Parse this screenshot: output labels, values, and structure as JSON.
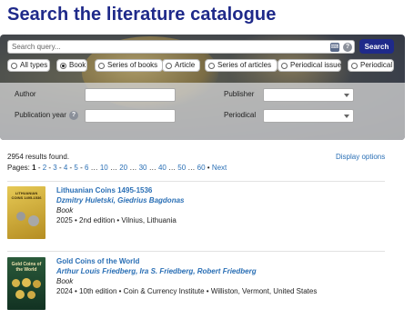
{
  "page_title": "Search the literature catalogue",
  "search": {
    "placeholder": "Search query...",
    "button_label": "Search",
    "keyboard_icon": "keyboard-icon",
    "help_icon": "?"
  },
  "types": [
    {
      "label": "All types",
      "selected": false
    },
    {
      "label": "Book",
      "selected": true
    },
    {
      "label": "Series of books",
      "selected": false
    },
    {
      "label": "Article",
      "selected": false
    },
    {
      "label": "Series of articles",
      "selected": false
    },
    {
      "label": "Periodical issue",
      "selected": false
    },
    {
      "label": "Periodical",
      "selected": false
    }
  ],
  "filters": {
    "author_label": "Author",
    "publication_year_label": "Publication year",
    "publisher_label": "Publisher",
    "periodical_label": "Periodical",
    "help_icon": "?"
  },
  "results": {
    "count_text": "2954 results found.",
    "display_options": "Display options",
    "pages_label": "Pages:",
    "current_page": "1",
    "pages": [
      "2",
      "3",
      "4",
      "5",
      "6",
      "10",
      "20",
      "30",
      "40",
      "50",
      "60"
    ],
    "next_label": "Next"
  },
  "books": [
    {
      "title": "Lithuanian Coins 1495-1536",
      "authors": "Dzmitry Huletski, Giedrius Bagdonas",
      "type": "Book",
      "meta": "2025 • 2nd edition • Vilnius, Lithuania",
      "cover_text": "LITHUANIAN COINS 1495-1536",
      "cover_color": "#c9a73a"
    },
    {
      "title": "Gold Coins of the World",
      "authors": "Arthur Louis Friedberg, Ira S. Friedberg, Robert Friedberg",
      "type": "Book",
      "meta": "2024 • 10th edition • Coin & Currency Institute • Williston, Vermont, United States",
      "cover_text": "Gold Coins of the World",
      "cover_color": "#1d4a2e"
    }
  ],
  "colors": {
    "brand": "#1f2a8a",
    "link": "#2a6fb5"
  }
}
